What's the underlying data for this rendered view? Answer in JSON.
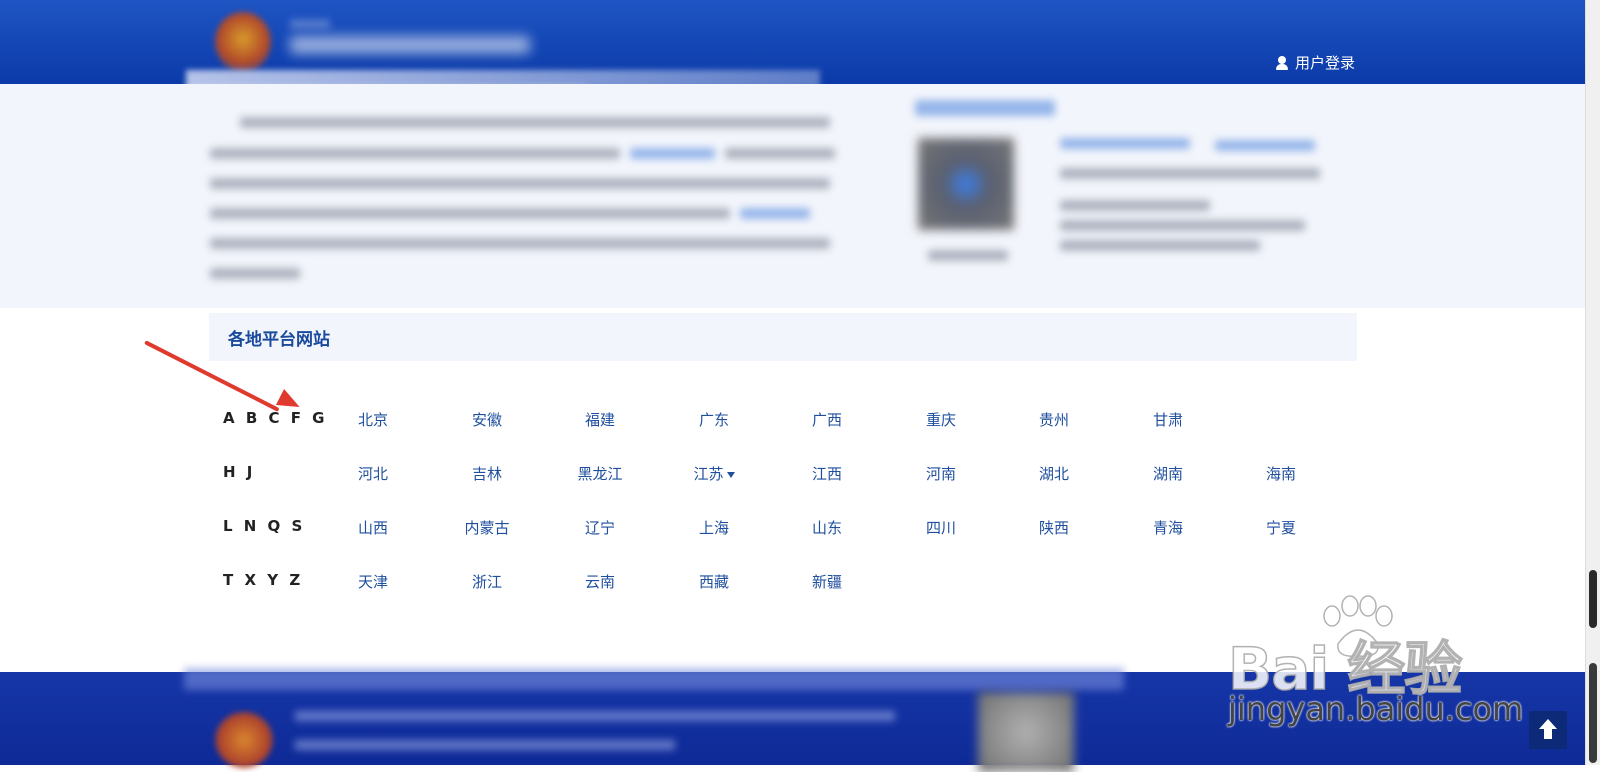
{
  "header": {
    "login_label": "用户登录"
  },
  "section": {
    "title": "各地平台网站"
  },
  "provinces": {
    "rows": [
      {
        "letters": "A B C F G",
        "items": [
          "北京",
          "安徽",
          "福建",
          "广东",
          "广西",
          "重庆",
          "贵州",
          "甘肃"
        ]
      },
      {
        "letters": "H J",
        "items": [
          "河北",
          "吉林",
          "黑龙江",
          "江苏",
          "江西",
          "河南",
          "湖北",
          "湖南",
          "海南"
        ]
      },
      {
        "letters": "L N Q S",
        "items": [
          "山西",
          "内蒙古",
          "辽宁",
          "上海",
          "山东",
          "四川",
          "陕西",
          "青海",
          "宁夏"
        ]
      },
      {
        "letters": "T X Y Z",
        "items": [
          "天津",
          "浙江",
          "云南",
          "西藏",
          "新疆"
        ]
      }
    ]
  },
  "watermark": {
    "brand": "Bai  经验",
    "url": "jingyan.baidu.com"
  },
  "colors": {
    "header_blue": "#1f55c4",
    "link_blue": "#1f4f9e",
    "footer_blue": "#0e2a96",
    "annotation_red": "#e03a2e"
  },
  "icons": {
    "login": "user-icon",
    "back_to_top": "arrow-up-icon"
  }
}
